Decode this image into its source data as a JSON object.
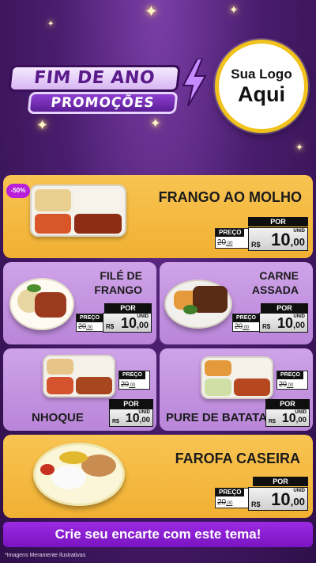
{
  "header": {
    "title_line1": "FIM DE ANO",
    "title_line2": "PROMOÇÕES",
    "logo_line1": "Sua Logo",
    "logo_line2": "Aqui"
  },
  "badge": {
    "discount": "-50%"
  },
  "products": [
    {
      "name": "FRANGO AO MOLHO",
      "preco_label": "PREÇO",
      "old_price": "20",
      "old_cents": ",00",
      "por_label": "POR",
      "currency": "R$",
      "new_price": "10",
      "new_cents": ",00",
      "unit": "UNID"
    },
    {
      "name_l1": "FILÉ DE",
      "name_l2": "FRANGO",
      "preco_label": "PREÇO",
      "old_price": "20",
      "old_cents": ",00",
      "por_label": "POR",
      "currency": "R$",
      "new_price": "10",
      "new_cents": ",00",
      "unit": "UNID"
    },
    {
      "name_l1": "CARNE",
      "name_l2": "ASSADA",
      "preco_label": "PREÇO",
      "old_price": "20",
      "old_cents": ",00",
      "por_label": "POR",
      "currency": "R$",
      "new_price": "10",
      "new_cents": ",00",
      "unit": "UNID"
    },
    {
      "name": "NHOQUE",
      "preco_label": "PREÇO",
      "old_price": "20",
      "old_cents": ",00",
      "por_label": "POR",
      "currency": "R$",
      "new_price": "10",
      "new_cents": ",00",
      "unit": "UNID"
    },
    {
      "name": "PURE DE BATATA",
      "preco_label": "PREÇO",
      "old_price": "20",
      "old_cents": ",00",
      "por_label": "POR",
      "currency": "R$",
      "new_price": "10",
      "new_cents": ",00",
      "unit": "UNID"
    },
    {
      "name": "FAROFA CASEIRA",
      "preco_label": "PREÇO",
      "old_price": "20",
      "old_cents": ",00",
      "por_label": "POR",
      "currency": "R$",
      "new_price": "10",
      "new_cents": ",00",
      "unit": "UNID"
    }
  ],
  "cta": {
    "label": "Crie seu encarte com este tema!"
  },
  "footnote": "*Imagens Meramente Ilustrativas",
  "colors": {
    "gold_card": "#f3b53a",
    "lilac_card": "#c495e0",
    "accent_purple": "#8a1fd0",
    "background": "#4a1d6e"
  },
  "icons": [
    "sparkle-icon",
    "lightning-bolt-icon"
  ]
}
